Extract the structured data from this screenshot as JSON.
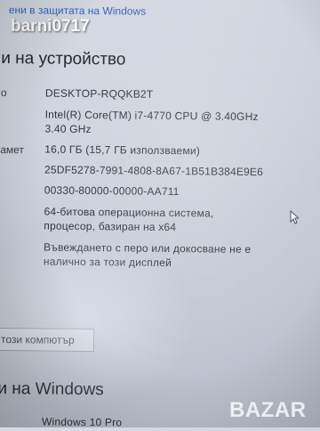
{
  "top_link": "ени в защитата на Windows",
  "username": "barni0717",
  "device_section": {
    "title": "и на устройство",
    "rows": [
      {
        "label": "о",
        "value": "DESKTOP-RQQKB2T"
      },
      {
        "label": "",
        "value": "Intel(R) Core(TM) i7-4770 CPU @ 3.40GHz"
      },
      {
        "label": "",
        "value": "3.40 GHz"
      },
      {
        "label": "амет",
        "value": "16,0 ГБ (15,7 ГБ използваеми)"
      },
      {
        "label": "",
        "value": "25DF5278-7991-4808-8A67-1B51B384E9E6"
      },
      {
        "label": "",
        "value": "00330-80000-00000-AA711"
      },
      {
        "label": "",
        "value": "64-битова операционна система,"
      },
      {
        "label": "",
        "value": "процесор, базиран на x64"
      },
      {
        "label": "",
        "value": "Въвеждането с перо или докосване не е"
      },
      {
        "label": "",
        "value": "налично за този дисплей"
      }
    ]
  },
  "rename_button": "този компютър",
  "windows_section": {
    "title": "и на Windows",
    "edition": "Windows 10 Pro"
  },
  "watermark": "BAZAR"
}
